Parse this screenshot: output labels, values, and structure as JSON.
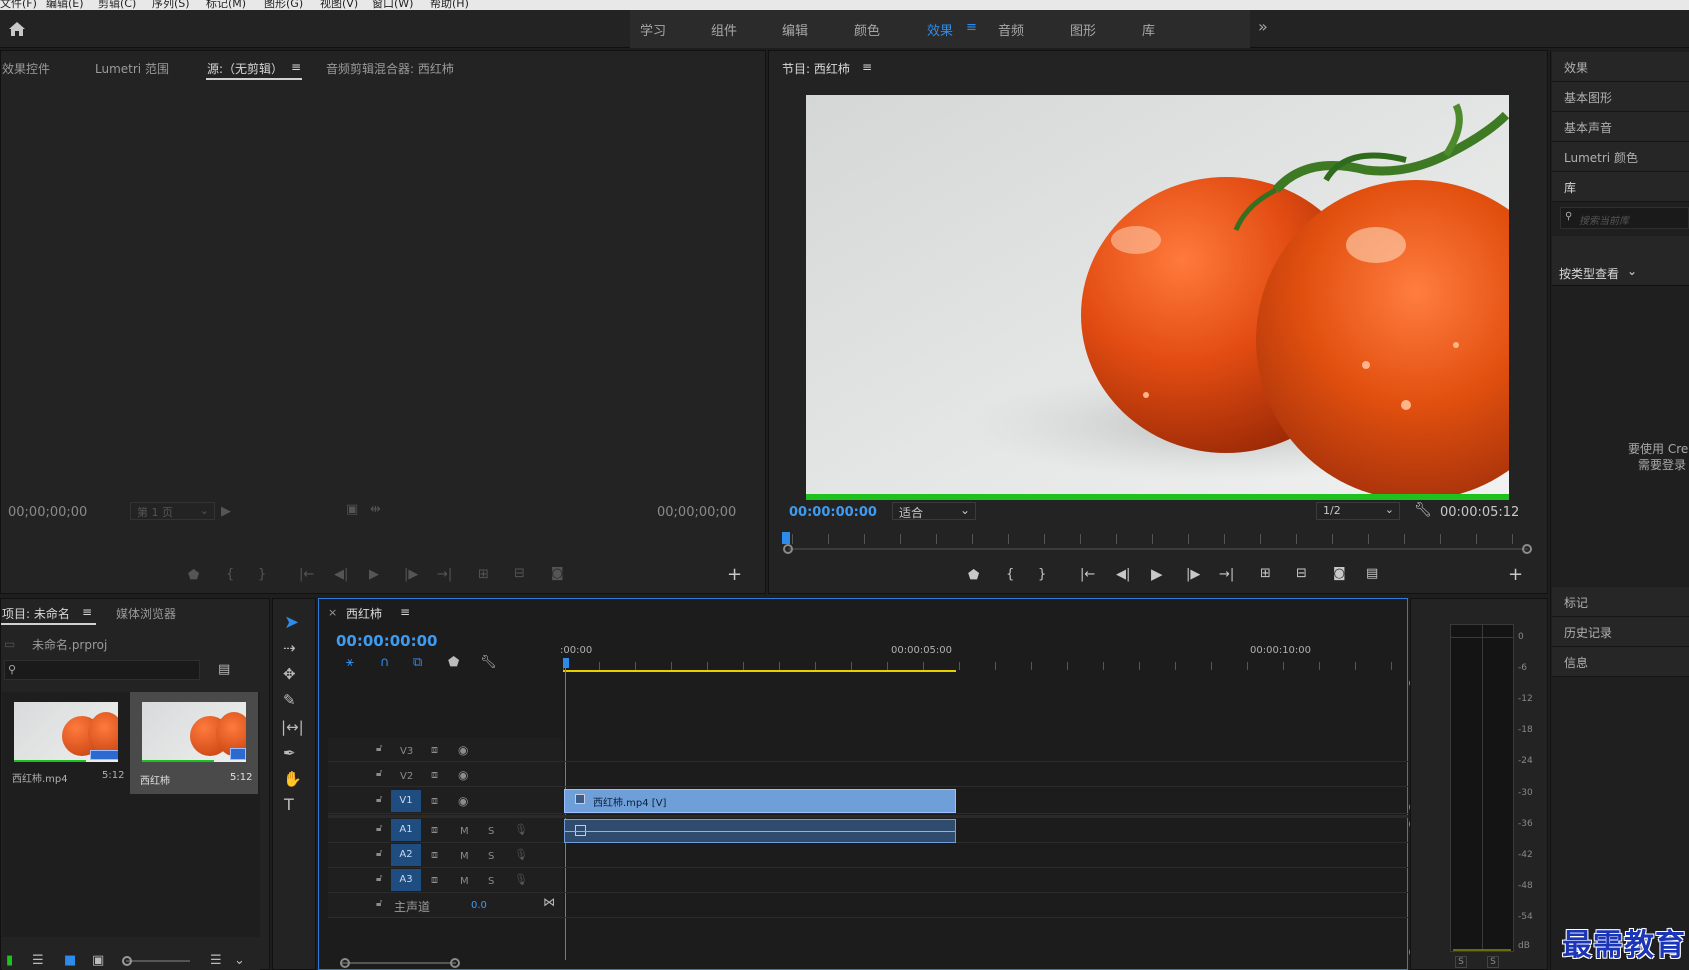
{
  "menu": [
    "文件(F)",
    "编辑(E)",
    "剪辑(C)",
    "序列(S)",
    "标记(M)",
    "图形(G)",
    "视图(V)",
    "窗口(W)",
    "帮助(H)"
  ],
  "workspaces": [
    "学习",
    "组件",
    "编辑",
    "颜色",
    "效果",
    "音频",
    "图形",
    "库"
  ],
  "active_workspace": "效果",
  "workspace_more": "»",
  "source_panel": {
    "tabs": [
      "效果控件",
      "Lumetri 范围",
      "源:（无剪辑）",
      "音频剪辑混合器: 西红柿"
    ],
    "timecode_left": "00;00;00;00",
    "page_select": "第 1 页",
    "timecode_right": "00;00;00;00"
  },
  "program_panel": {
    "title": "节目: 西红柿",
    "timecode": "00:00:00:00",
    "fit": "适合",
    "resolution": "1/2",
    "duration": "00:00:05:12"
  },
  "right_panel": {
    "items_top": [
      "效果",
      "基本图形",
      "基本声音",
      "Lumetri 颜色",
      "库"
    ],
    "search_placeholder": "搜索当前库",
    "view_by": "按类型查看",
    "cc_message_line1": "要使用 Crea",
    "cc_message_line2": "需要登录",
    "items_bottom": [
      "标记",
      "历史记录",
      "信息"
    ]
  },
  "project_panel": {
    "tabs": [
      "项目: 未命名",
      "媒体浏览器"
    ],
    "file": "未命名.prproj",
    "items": [
      {
        "name": "西红柿.mp4",
        "duration": "5:12"
      },
      {
        "name": "西红柿",
        "duration": "5:12"
      }
    ]
  },
  "timeline": {
    "tab": "西红柿",
    "timecode": "00:00:00:00",
    "ruler": [
      ":00:00",
      "00:00:05:00",
      "00:00:10:00"
    ],
    "video_tracks": [
      "V3",
      "V2",
      "V1"
    ],
    "audio_tracks": [
      "A1",
      "A2",
      "A3"
    ],
    "mute": "M",
    "solo": "S",
    "master": "主声道",
    "master_value": "0.0",
    "clip_video": "西红柿.mp4 [V]"
  },
  "meter": {
    "scale": [
      "0",
      "-6",
      "-12",
      "-18",
      "-24",
      "-30",
      "-36",
      "-42",
      "-48",
      "-54",
      "dB"
    ],
    "solo_labels": [
      "S",
      "S"
    ]
  },
  "watermark": "最需教育",
  "colors": {
    "accent": "#2d8ceb",
    "timeline_clip": "#6f9fd8",
    "green_bar": "#1ec21e"
  }
}
